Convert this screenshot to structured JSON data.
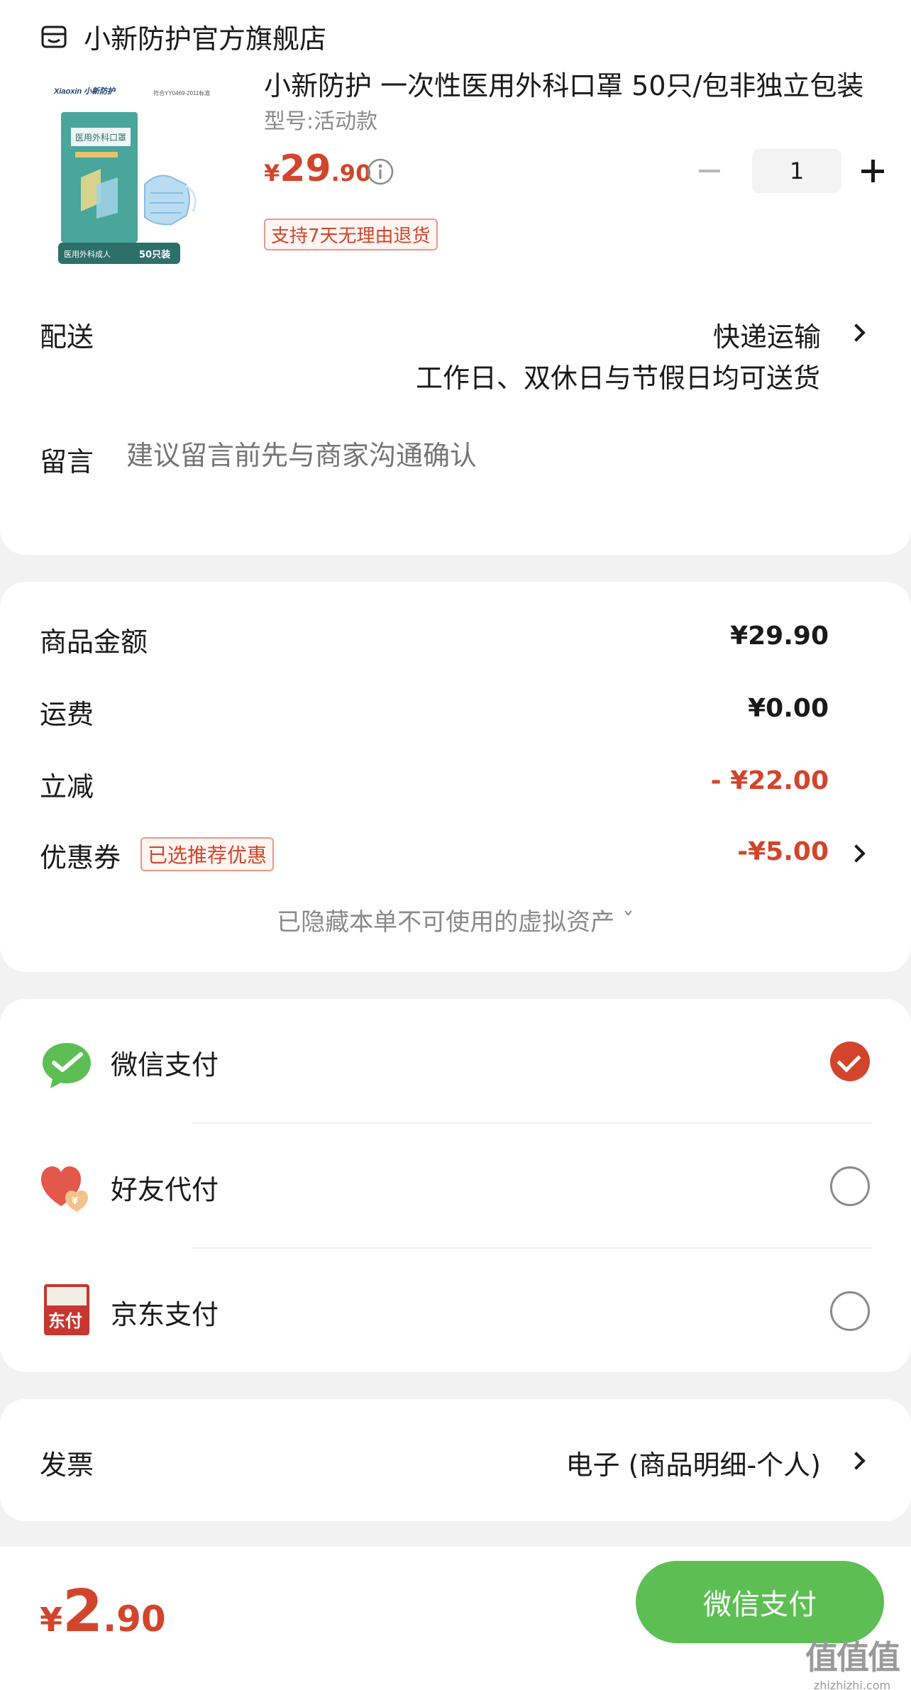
{
  "store": {
    "name": "小新防护官方旗舰店",
    "icon": "store-icon"
  },
  "product": {
    "title": "小新防护 一次性医用外科口罩 50只/包非独立包装",
    "spec": "型号:活动款",
    "price_symbol": "¥",
    "price_int": "29",
    "price_dec": ".90",
    "quantity": "1",
    "return_policy": "支持7天无理由退货",
    "image": {
      "brand": "Xiaoxin 小新防护",
      "standard": "符合YY0469-2011标准",
      "package_title": "医用外科口罩",
      "footer_left": "医用外科成人",
      "footer_right": "50只装"
    }
  },
  "delivery": {
    "label": "配送",
    "method": "快递运输",
    "note": "工作日、双休日与节假日均可送货"
  },
  "message": {
    "label": "留言",
    "placeholder": "建议留言前先与商家沟通确认"
  },
  "amounts": {
    "goods_label": "商品金额",
    "goods_value": "¥29.90",
    "shipping_label": "运费",
    "shipping_value": "¥0.00",
    "discount_label": "立减",
    "discount_value": "- ¥22.00",
    "coupon_label": "优惠券",
    "coupon_badge": "已选推荐优惠",
    "coupon_value": "-¥5.00",
    "hidden_assets": "已隐藏本单不可使用的虚拟资产 ˇ"
  },
  "payment": {
    "options": [
      {
        "label": "微信支付",
        "icon": "wechat-pay-icon",
        "selected": true
      },
      {
        "label": "好友代付",
        "icon": "friend-pay-icon",
        "selected": false
      },
      {
        "label": "京东支付",
        "icon": "jd-pay-icon",
        "selected": false
      }
    ],
    "jd_icon_text": "东付",
    "friend_icon_text": "¥"
  },
  "invoice": {
    "label": "发票",
    "value": "电子 (商品明细-个人)"
  },
  "footer": {
    "total_symbol": "¥",
    "total_int": "2",
    "total_dec": ".90",
    "pay_button": "微信支付"
  },
  "watermark": {
    "glyphs": "值值值",
    "url": "zhizhizhi.com"
  },
  "colors": {
    "accent_red": "#d2452c",
    "wechat_green": "#5dbf53",
    "background": "#f2f2f2"
  }
}
